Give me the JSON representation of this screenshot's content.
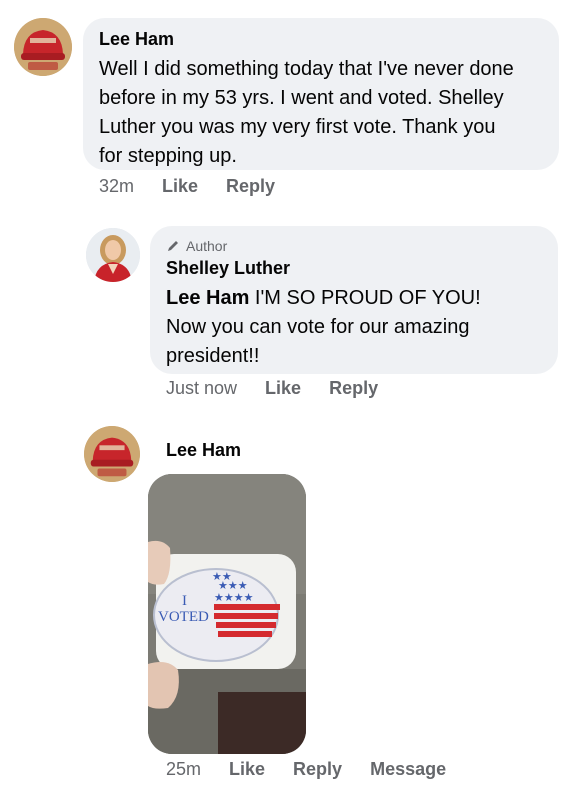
{
  "comments": [
    {
      "author": "Lee Ham",
      "avatar_text": "TRUMP",
      "text": "Well I did something today that I've never done before in my 53 yrs. I went and voted. Shelley Luther you was my very first vote. Thank you for stepping up.",
      "time": "32m",
      "like_label": "Like",
      "reply_label": "Reply"
    }
  ],
  "reply": {
    "badge": "Author",
    "author": "Shelley Luther",
    "tagged_name": "Lee Ham",
    "text": " I'M SO PROUD OF YOU! Now you can vote for our amazing president!!",
    "time": "Just now",
    "like_label": "Like",
    "reply_label": "Reply"
  },
  "photo_comment": {
    "author": "Lee Ham",
    "avatar_text": "TRUMP",
    "sticker_line1": "I",
    "sticker_line2": "VOTED",
    "time": "25m",
    "like_label": "Like",
    "reply_label": "Reply",
    "message_label": "Message"
  },
  "colors": {
    "bubble": "#eff1f4",
    "meta_text": "#65676b",
    "hat_red": "#c7252b",
    "flag_blue": "#3a5bb4",
    "flag_red": "#d42a2f"
  }
}
